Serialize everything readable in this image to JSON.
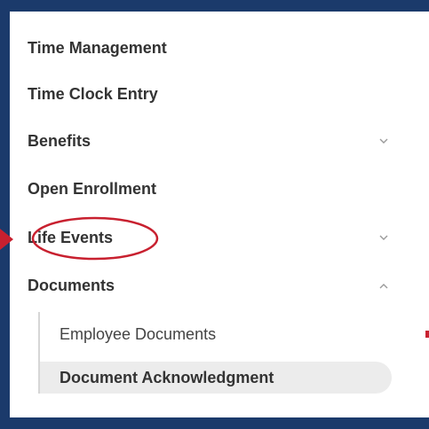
{
  "menu": {
    "items": [
      {
        "label": "Time Management",
        "has_chevron": false
      },
      {
        "label": "Time Clock Entry",
        "has_chevron": false
      },
      {
        "label": "Benefits",
        "has_chevron": true,
        "chevron": "chevron-down-icon"
      },
      {
        "label": "Open Enrollment",
        "has_chevron": false
      },
      {
        "label": "Life Events",
        "has_chevron": true,
        "chevron": "chevron-down-icon",
        "highlighted": true
      },
      {
        "label": "Documents",
        "has_chevron": true,
        "chevron": "chevron-up-icon",
        "expanded": true
      }
    ],
    "documents_subitems": [
      {
        "label": "Employee Documents",
        "active": false
      },
      {
        "label": "Document Acknowledgment",
        "active": true
      }
    ]
  },
  "colors": {
    "frame": "#1b3a6b",
    "annotation": "#c8202f",
    "active_bg": "#ececec"
  }
}
